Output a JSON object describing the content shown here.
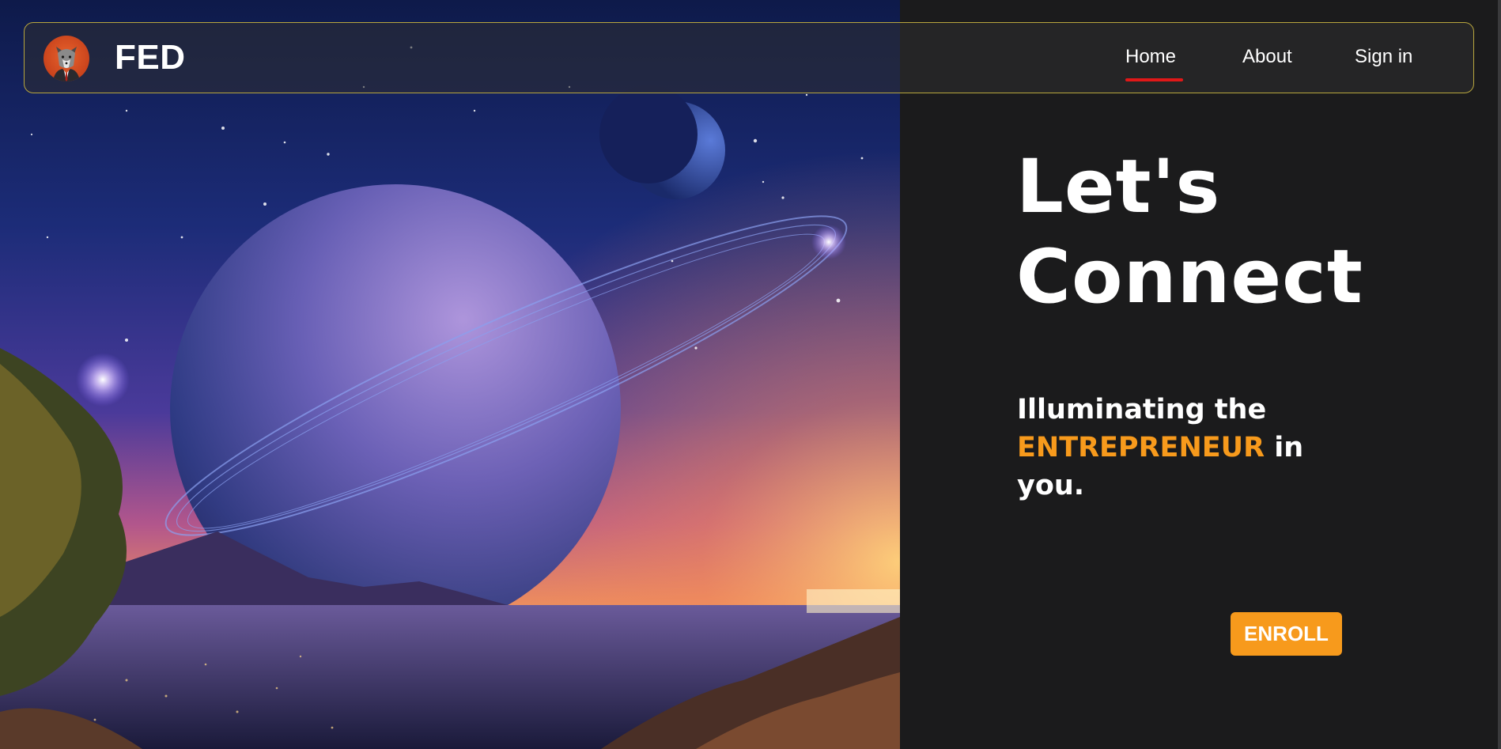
{
  "navbar": {
    "brand": "FED",
    "logo_icon": "wolf-avatar-icon",
    "links": [
      {
        "label": "Home",
        "active": true
      },
      {
        "label": "About",
        "active": false
      },
      {
        "label": "Sign in",
        "active": false
      }
    ],
    "active_indicator_color": "#e01818",
    "border_color": "#b8a63e"
  },
  "hero": {
    "headline_line1": "Let's",
    "headline_line2": "Connect",
    "tagline_part1": "Illuminating the",
    "tagline_accent": "ENTREPRENEUR",
    "tagline_part2": "in",
    "tagline_part3": "you.",
    "accent_color": "#f79a1c",
    "cta_label": "ENROLL",
    "illustration": "ringed-planet-night-sky-illustration"
  },
  "colors": {
    "background": "#1b1b1c",
    "text": "#ffffff",
    "accent": "#f79a1c"
  }
}
